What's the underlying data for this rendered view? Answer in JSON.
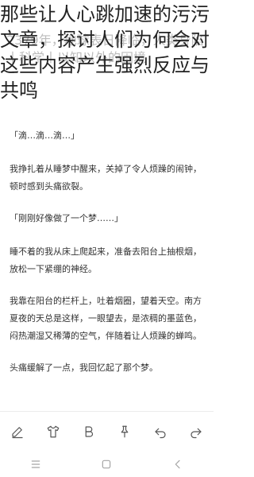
{
  "headline": "那些让人心跳加速的污污文章，探讨人们为何会对这些内容产生强烈反应与共鸣",
  "ghost_title": "2379年，地球表日降临，人类身陷丨科学丨以知以外的困境",
  "paragraphs": [
    "「滴…滴…滴…」",
    "我挣扎着从睡梦中醒来，关掉了令人烦躁的闹钟，顿时感到头痛欲裂。",
    "「刚刚好像做了一个梦……」",
    "睡不着的我从床上爬起来，准备去阳台上抽根烟，放松一下紧绷的神经。",
    "我靠在阳台的栏杆上，吐着烟圈，望着天空。南方夏夜的天总是这样，一眼望去，是浓稠的墨蓝色，闷热潮湿又稀薄的空气，伴随着让人烦躁的蝉鸣。",
    "头痛缓解了一点，我回忆起了那个梦。"
  ],
  "toolbar": {
    "icons": [
      "edit-icon",
      "shirt-icon",
      "bold-text-icon",
      "pin-icon",
      "undo-icon",
      "redo-icon"
    ]
  },
  "navbar": {
    "icons": [
      "menu-icon",
      "home-icon",
      "back-icon"
    ]
  }
}
